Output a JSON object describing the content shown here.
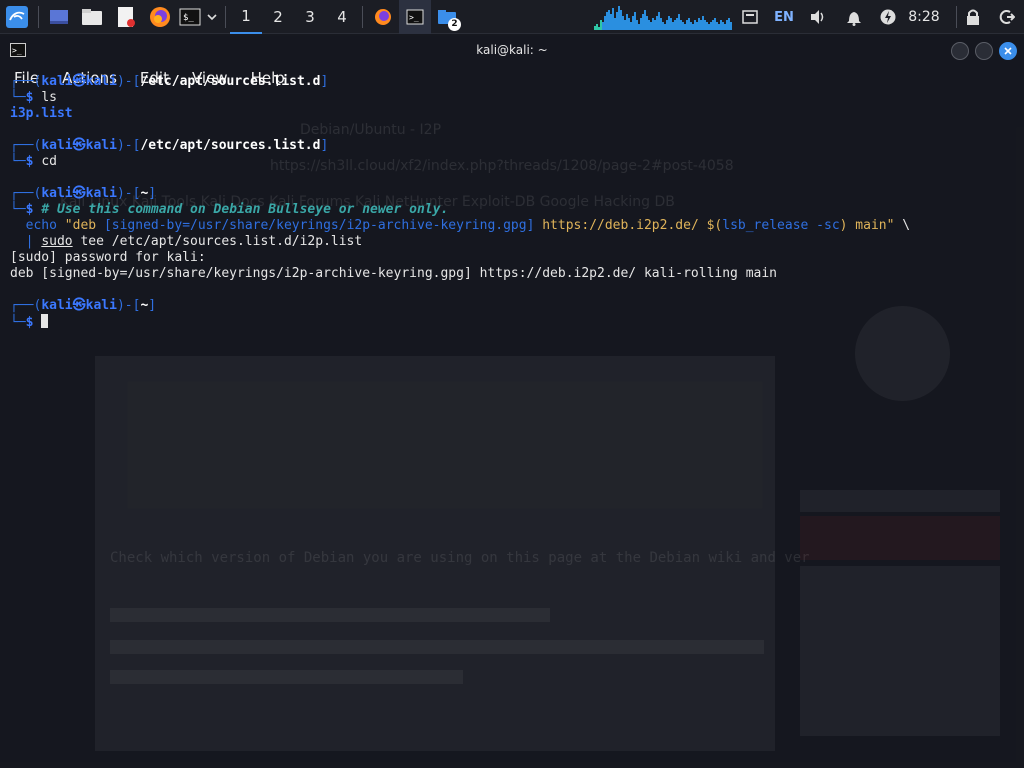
{
  "panel": {
    "workspaces": [
      "1",
      "2",
      "3",
      "4"
    ],
    "active_workspace": "1",
    "terminal_badge": "2",
    "language": "EN",
    "clock": "8:28"
  },
  "window": {
    "title": "kali@kali: ~"
  },
  "menubar": [
    "File",
    "Actions",
    "Edit",
    "View",
    "Help"
  ],
  "terminal": {
    "user": "kali",
    "host": "kali",
    "block1": {
      "path": "/etc/apt/sources.list.d",
      "command": "ls",
      "output": "i3p.list"
    },
    "block2": {
      "path": "/etc/apt/sources.list.d",
      "command": "cd"
    },
    "block3": {
      "path": "~",
      "comment": "# Use this command on Debian Bullseye or newer only.",
      "echo": "echo",
      "string_start": "\"deb ",
      "bracket": "[signed-by=/usr/share/keyrings/i2p-archive-keyring.gpg]",
      "url": " https://deb.i2p2.de/ ",
      "subst_open": "$(",
      "subst_cmd": "lsb_release -sc",
      "subst_close": ")",
      "string_end": " main\"",
      "continuation": " \\",
      "pipe": "|",
      "sudo": "sudo",
      "tee": " tee /etc/apt/sources.list.d/i2p.list",
      "sudo_prompt": "[sudo] password for kali:",
      "tee_output": "deb [signed-by=/usr/share/keyrings/i2p-archive-keyring.gpg] https://deb.i2p2.de/ kali-rolling main"
    },
    "block4": {
      "path": "~"
    }
  },
  "colors": {
    "panel_bg": "#1b1d24",
    "terminal_bg": "#16181f",
    "prompt_blue": "#2f6fe0",
    "comment_teal": "#3aa7a7",
    "string_yellow": "#e0b45a"
  }
}
